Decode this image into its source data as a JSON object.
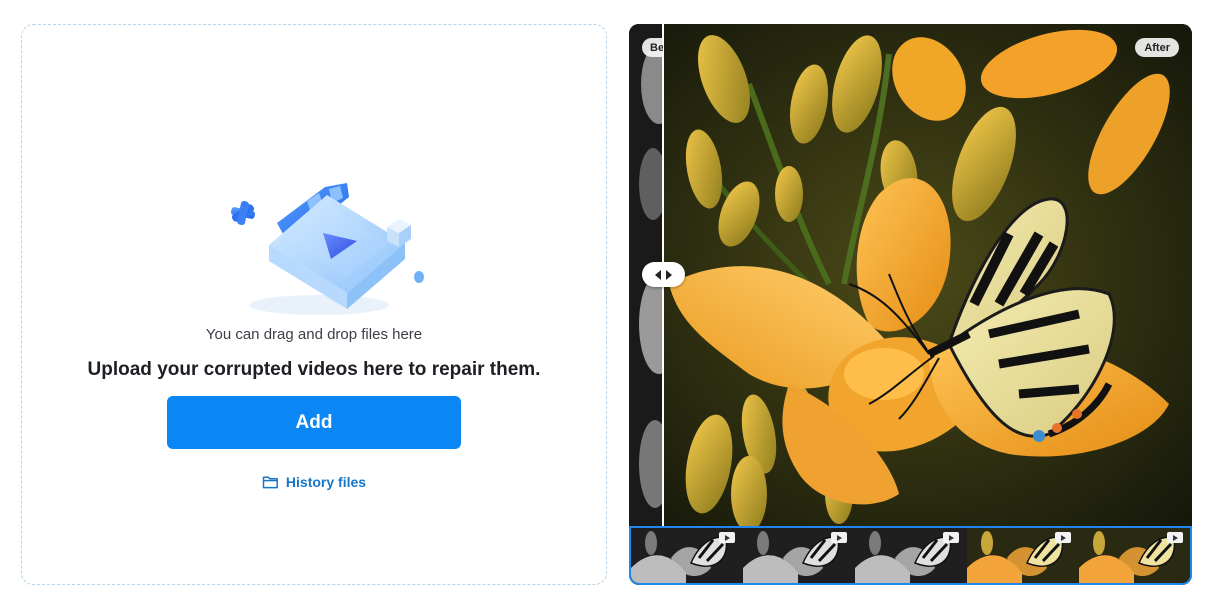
{
  "upload": {
    "drag_hint": "You can drag and drop files here",
    "title": "Upload your corrupted videos here to repair them.",
    "add_label": "Add",
    "history_label": "History files",
    "illustration_icon": "video-repair-illustration",
    "history_icon": "folder-icon"
  },
  "preview": {
    "before_label": "Before",
    "after_label": "After",
    "handle_icon": "left-right-arrows-icon",
    "play_icon": "play-icon",
    "frames": [
      {
        "mode": "grayscale"
      },
      {
        "mode": "grayscale"
      },
      {
        "mode": "grayscale"
      },
      {
        "mode": "color"
      },
      {
        "mode": "color"
      }
    ]
  },
  "colors": {
    "accent": "#0a86f5",
    "link": "#1677c9",
    "filmstrip_border": "#1f86f0"
  }
}
